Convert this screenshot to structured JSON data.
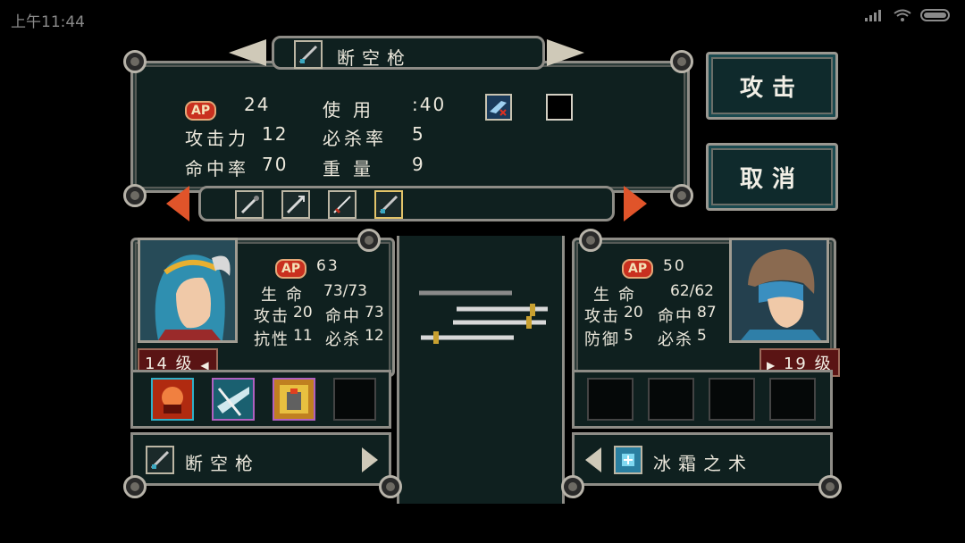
{
  "status_bar": {
    "time": "上午11:44"
  },
  "weapon": {
    "name": "断空枪",
    "ap_label": "AP",
    "ap": "24",
    "use_label": "使用",
    "use_value": ":40",
    "attack_label": "攻击力",
    "attack": "12",
    "crit_label": "必杀率",
    "crit": "5",
    "hit_label": "命中率",
    "hit": "70",
    "weight_label": "重量",
    "weight": "9"
  },
  "buttons": {
    "attack": "攻击",
    "cancel": "取消"
  },
  "player": {
    "ap_label": "AP",
    "ap": "63",
    "hp_label": "生命",
    "hp": "73/73",
    "atk_label": "攻击",
    "atk": "20",
    "hit_label": "命中",
    "hit": "73",
    "res_label": "抗性",
    "res": "11",
    "crit_label": "必杀",
    "crit": "12",
    "level": "14",
    "level_unit": "级",
    "equip_name": "断空枪"
  },
  "enemy": {
    "ap_label": "AP",
    "ap": "50",
    "hp_label": "生命",
    "hp": "62/62",
    "atk_label": "攻击",
    "atk": "20",
    "hit_label": "命中",
    "hit": "87",
    "def_label": "防御",
    "def": "5",
    "crit_label": "必杀",
    "crit": "5",
    "level": "19",
    "level_unit": "级",
    "equip_name": "冰霜之术"
  },
  "colors": {
    "panel_bg": "#0f201f",
    "frame": "#8e8c86",
    "ap_badge": "#c9301f",
    "arrow": "#e0542a",
    "level_bg": "#5a1414"
  }
}
